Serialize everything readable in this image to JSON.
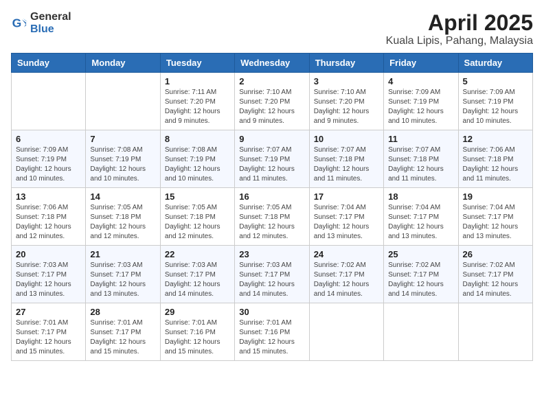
{
  "header": {
    "logo_general": "General",
    "logo_blue": "Blue",
    "month_title": "April 2025",
    "location": "Kuala Lipis, Pahang, Malaysia"
  },
  "days_of_week": [
    "Sunday",
    "Monday",
    "Tuesday",
    "Wednesday",
    "Thursday",
    "Friday",
    "Saturday"
  ],
  "weeks": [
    [
      {
        "day": "",
        "info": ""
      },
      {
        "day": "",
        "info": ""
      },
      {
        "day": "1",
        "info": "Sunrise: 7:11 AM\nSunset: 7:20 PM\nDaylight: 12 hours and 9 minutes."
      },
      {
        "day": "2",
        "info": "Sunrise: 7:10 AM\nSunset: 7:20 PM\nDaylight: 12 hours and 9 minutes."
      },
      {
        "day": "3",
        "info": "Sunrise: 7:10 AM\nSunset: 7:20 PM\nDaylight: 12 hours and 9 minutes."
      },
      {
        "day": "4",
        "info": "Sunrise: 7:09 AM\nSunset: 7:19 PM\nDaylight: 12 hours and 10 minutes."
      },
      {
        "day": "5",
        "info": "Sunrise: 7:09 AM\nSunset: 7:19 PM\nDaylight: 12 hours and 10 minutes."
      }
    ],
    [
      {
        "day": "6",
        "info": "Sunrise: 7:09 AM\nSunset: 7:19 PM\nDaylight: 12 hours and 10 minutes."
      },
      {
        "day": "7",
        "info": "Sunrise: 7:08 AM\nSunset: 7:19 PM\nDaylight: 12 hours and 10 minutes."
      },
      {
        "day": "8",
        "info": "Sunrise: 7:08 AM\nSunset: 7:19 PM\nDaylight: 12 hours and 10 minutes."
      },
      {
        "day": "9",
        "info": "Sunrise: 7:07 AM\nSunset: 7:19 PM\nDaylight: 12 hours and 11 minutes."
      },
      {
        "day": "10",
        "info": "Sunrise: 7:07 AM\nSunset: 7:18 PM\nDaylight: 12 hours and 11 minutes."
      },
      {
        "day": "11",
        "info": "Sunrise: 7:07 AM\nSunset: 7:18 PM\nDaylight: 12 hours and 11 minutes."
      },
      {
        "day": "12",
        "info": "Sunrise: 7:06 AM\nSunset: 7:18 PM\nDaylight: 12 hours and 11 minutes."
      }
    ],
    [
      {
        "day": "13",
        "info": "Sunrise: 7:06 AM\nSunset: 7:18 PM\nDaylight: 12 hours and 12 minutes."
      },
      {
        "day": "14",
        "info": "Sunrise: 7:05 AM\nSunset: 7:18 PM\nDaylight: 12 hours and 12 minutes."
      },
      {
        "day": "15",
        "info": "Sunrise: 7:05 AM\nSunset: 7:18 PM\nDaylight: 12 hours and 12 minutes."
      },
      {
        "day": "16",
        "info": "Sunrise: 7:05 AM\nSunset: 7:18 PM\nDaylight: 12 hours and 12 minutes."
      },
      {
        "day": "17",
        "info": "Sunrise: 7:04 AM\nSunset: 7:17 PM\nDaylight: 12 hours and 13 minutes."
      },
      {
        "day": "18",
        "info": "Sunrise: 7:04 AM\nSunset: 7:17 PM\nDaylight: 12 hours and 13 minutes."
      },
      {
        "day": "19",
        "info": "Sunrise: 7:04 AM\nSunset: 7:17 PM\nDaylight: 12 hours and 13 minutes."
      }
    ],
    [
      {
        "day": "20",
        "info": "Sunrise: 7:03 AM\nSunset: 7:17 PM\nDaylight: 12 hours and 13 minutes."
      },
      {
        "day": "21",
        "info": "Sunrise: 7:03 AM\nSunset: 7:17 PM\nDaylight: 12 hours and 13 minutes."
      },
      {
        "day": "22",
        "info": "Sunrise: 7:03 AM\nSunset: 7:17 PM\nDaylight: 12 hours and 14 minutes."
      },
      {
        "day": "23",
        "info": "Sunrise: 7:03 AM\nSunset: 7:17 PM\nDaylight: 12 hours and 14 minutes."
      },
      {
        "day": "24",
        "info": "Sunrise: 7:02 AM\nSunset: 7:17 PM\nDaylight: 12 hours and 14 minutes."
      },
      {
        "day": "25",
        "info": "Sunrise: 7:02 AM\nSunset: 7:17 PM\nDaylight: 12 hours and 14 minutes."
      },
      {
        "day": "26",
        "info": "Sunrise: 7:02 AM\nSunset: 7:17 PM\nDaylight: 12 hours and 14 minutes."
      }
    ],
    [
      {
        "day": "27",
        "info": "Sunrise: 7:01 AM\nSunset: 7:17 PM\nDaylight: 12 hours and 15 minutes."
      },
      {
        "day": "28",
        "info": "Sunrise: 7:01 AM\nSunset: 7:17 PM\nDaylight: 12 hours and 15 minutes."
      },
      {
        "day": "29",
        "info": "Sunrise: 7:01 AM\nSunset: 7:16 PM\nDaylight: 12 hours and 15 minutes."
      },
      {
        "day": "30",
        "info": "Sunrise: 7:01 AM\nSunset: 7:16 PM\nDaylight: 12 hours and 15 minutes."
      },
      {
        "day": "",
        "info": ""
      },
      {
        "day": "",
        "info": ""
      },
      {
        "day": "",
        "info": ""
      }
    ]
  ]
}
